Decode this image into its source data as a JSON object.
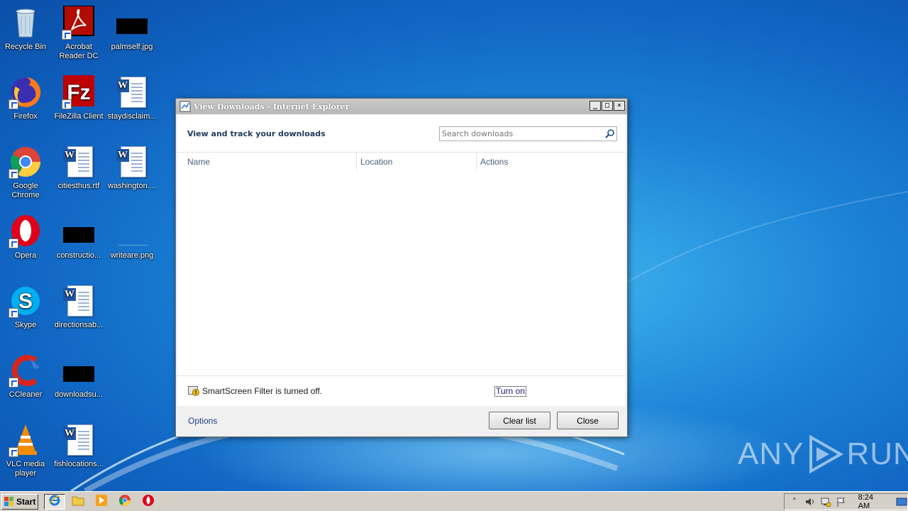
{
  "desktop": {
    "icons": [
      {
        "label": "Recycle Bin",
        "icon": "recycle-bin-icon"
      },
      {
        "label": "Acrobat Reader DC",
        "icon": "acrobat-icon"
      },
      {
        "label": "palmself.jpg",
        "icon": "image-file-icon"
      },
      {
        "label": "Firefox",
        "icon": "firefox-icon"
      },
      {
        "label": "FileZilla Client",
        "icon": "filezilla-icon"
      },
      {
        "label": "staydisclaim...",
        "icon": "word-doc-icon"
      },
      {
        "label": "Google Chrome",
        "icon": "chrome-icon"
      },
      {
        "label": "citiesthus.rtf",
        "icon": "word-doc-icon"
      },
      {
        "label": "washington....",
        "icon": "word-doc-icon"
      },
      {
        "label": "Opera",
        "icon": "opera-icon"
      },
      {
        "label": "constructio...",
        "icon": "image-file-icon"
      },
      {
        "label": "writeare.png",
        "icon": "image-file-icon"
      },
      {
        "label": "Skype",
        "icon": "skype-icon"
      },
      {
        "label": "directionsab...",
        "icon": "word-doc-icon"
      },
      {
        "label": "CCleaner",
        "icon": "ccleaner-icon"
      },
      {
        "label": "downloadsu...",
        "icon": "image-file-icon"
      },
      {
        "label": "VLC media player",
        "icon": "vlc-icon"
      },
      {
        "label": "fishlocations...",
        "icon": "word-doc-icon"
      }
    ]
  },
  "window": {
    "title": "View Downloads - Internet Explorer",
    "heading": "View and track your downloads",
    "search_placeholder": "Search downloads",
    "columns": [
      "Name",
      "Location",
      "Actions"
    ],
    "smartscreen_text": "SmartScreen Filter is turned off.",
    "turn_on_label": "Turn on",
    "options_label": "Options",
    "clear_list_label": "Clear list",
    "close_label": "Close",
    "controls": {
      "minimize": "_",
      "maximize": "□",
      "close": "✕"
    }
  },
  "taskbar": {
    "start_label": "Start",
    "apps": [
      "internet-explorer-icon",
      "explorer-folder-icon",
      "media-player-icon",
      "chrome-icon",
      "opera-icon"
    ],
    "clock": "8:24 AM"
  },
  "watermark": {
    "left": "ANY",
    "right": "RUN"
  },
  "colors": {
    "accent": "#1e395b",
    "link": "#1f3c8f",
    "desktop": "#1c83d6"
  }
}
